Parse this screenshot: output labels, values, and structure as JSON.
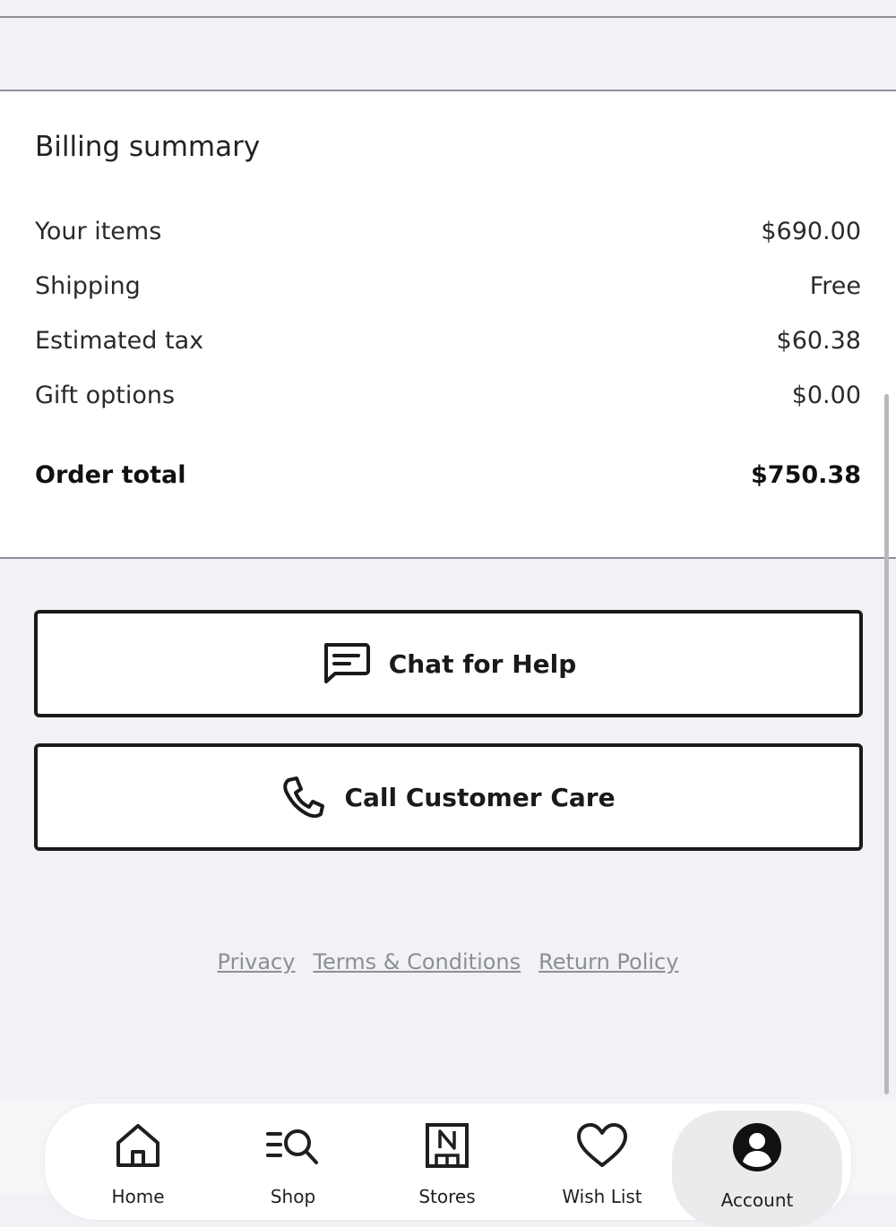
{
  "billing": {
    "title": "Billing summary",
    "rows": [
      {
        "label": "Your items",
        "value": "$690.00"
      },
      {
        "label": "Shipping",
        "value": "Free"
      },
      {
        "label": "Estimated tax",
        "value": "$60.38"
      },
      {
        "label": "Gift options",
        "value": "$0.00"
      }
    ],
    "total": {
      "label": "Order total",
      "value": "$750.38"
    }
  },
  "actions": {
    "chat": {
      "label": "Chat for Help",
      "icon": "chat-bubble-icon"
    },
    "call": {
      "label": "Call Customer Care",
      "icon": "phone-icon"
    }
  },
  "footer_links": [
    "Privacy",
    "Terms & Conditions",
    "Return Policy"
  ],
  "bottom_nav": {
    "items": [
      {
        "label": "Home",
        "icon": "home-icon"
      },
      {
        "label": "Shop",
        "icon": "shop-search-icon"
      },
      {
        "label": "Stores",
        "icon": "store-icon"
      },
      {
        "label": "Wish List",
        "icon": "heart-icon"
      },
      {
        "label": "Account",
        "icon": "account-icon",
        "active": true
      }
    ]
  }
}
